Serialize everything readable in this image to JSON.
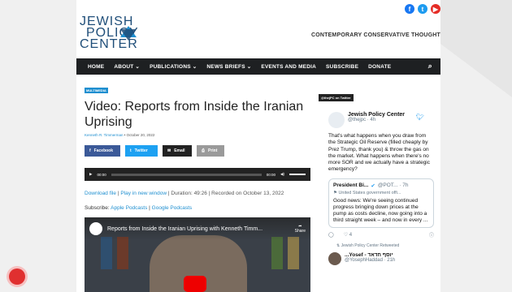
{
  "site": {
    "logo_lines": [
      "JEWISH",
      "POLICY",
      "CENTER"
    ],
    "tagline": "CONTEMPORARY CONSERVATIVE THOUGHT",
    "social": [
      {
        "icon": "facebook-icon",
        "glyph": "f",
        "color": "#1877f2"
      },
      {
        "icon": "twitter-icon",
        "glyph": "t",
        "color": "#1d9bf0"
      },
      {
        "icon": "youtube-icon",
        "glyph": "▶",
        "color": "#e52d27"
      }
    ],
    "accent": "#1f8fd0"
  },
  "nav": {
    "items": [
      "HOME",
      "ABOUT ⌄",
      "PUBLICATIONS ⌄",
      "NEWS BRIEFS ⌄",
      "EVENTS AND MEDIA",
      "SUBSCRIBE",
      "DONATE"
    ],
    "search_icon": "search-icon"
  },
  "article": {
    "badge": "MULTIMEDIA",
    "title": "Video: Reports from Inside the Iranian Uprising",
    "author": "Kenneth R. Timmerman",
    "date": "• October 20, 2022",
    "share": [
      {
        "label": "Facebook",
        "glyph": "f",
        "color": "#3b5998"
      },
      {
        "label": "Twitter",
        "glyph": "t",
        "color": "#1da1f2"
      },
      {
        "label": "Email",
        "glyph": "✉",
        "color": "#222"
      },
      {
        "label": "Print",
        "glyph": "⎙",
        "color": "#9a9a9a"
      }
    ],
    "player": {
      "time_start": "00:00",
      "time_end": "00:00"
    },
    "download": "Download file",
    "play_window": "Play in new window",
    "duration": "Duration: 49:26",
    "recorded": "Recorded on October 13, 2022",
    "subscribe_label": "Subscribe:",
    "apple": "Apple Podcasts",
    "google": "Google Podcasts",
    "video_title": "Reports from Inside the Iranian Uprising with Kenneth Timm...",
    "video_share": "Share"
  },
  "twitter": {
    "tag": "@thejPC on Twitter",
    "tweet": {
      "name": "Jewish Policy Center",
      "handle": "@thejpc · 4h",
      "text": "That's what happens when you draw from the Strategic Oil Reserve (filled cheaply by Prez Trump, thank you) & throw the gas on the market. What happens when there's no more SOR and we actually have a strategic emergency?",
      "quote": {
        "name": "President Bi...",
        "handle": "@POT... · 7h",
        "sub": "⚑ United States government offi...",
        "text": "Good news: We're seeing continued progress bringing down prices at the pump as costs decline, now going into a third straight week – and now in every ..."
      },
      "likes": "4"
    },
    "retweet_line": "⇅ Jewish Policy Center Retweeted",
    "tweet2": {
      "name": "...Yosef - יוסף חדאד",
      "handle": "@YosephHaddad · 21h"
    }
  }
}
